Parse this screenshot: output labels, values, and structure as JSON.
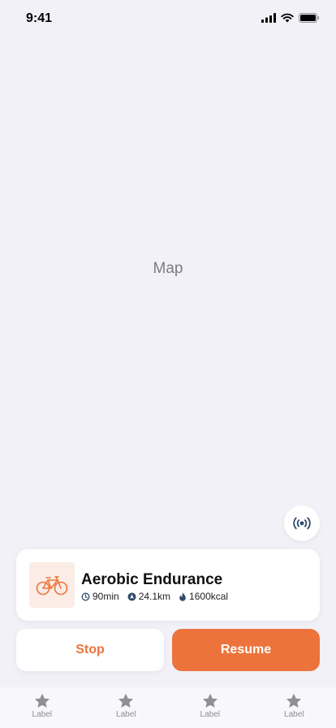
{
  "status_bar": {
    "time": "9:41"
  },
  "map": {
    "placeholder": "Map"
  },
  "workout": {
    "title": "Aerobic Endurance",
    "duration": "90min",
    "distance": "24.1km",
    "calories": "1600kcal"
  },
  "actions": {
    "stop_label": "Stop",
    "resume_label": "Resume"
  },
  "tabs": [
    {
      "label": "Label",
      "icon": "star-icon"
    },
    {
      "label": "Label",
      "icon": "star-icon"
    },
    {
      "label": "Label",
      "icon": "star-icon"
    },
    {
      "label": "Label",
      "icon": "star-icon"
    }
  ],
  "colors": {
    "accent": "#ec743c",
    "accent_tint": "#fbece6",
    "background": "#f2f1f7",
    "stat_icon": "#2f4a6b"
  }
}
